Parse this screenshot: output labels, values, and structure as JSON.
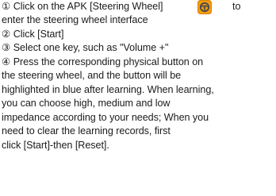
{
  "instructions": {
    "step1_before_icon": "① Click on the APK [Steering Wheel]",
    "step1_icon": "steering-wheel-icon",
    "step1_after_icon": "to",
    "step1_line2": "enter the steering wheel interface",
    "step2": "② Click [Start]",
    "step3": "③ Select one key, such as \"Volume +\"",
    "step4_lines": [
      "④ Press the corresponding physical button on",
      "the steering wheel, and the button will be",
      "highlighted in blue after learning. When learning,",
      "you can choose high, medium and low",
      "impedance according to your needs; When you",
      "need to clear the learning records, first",
      "click [Start]-then [Reset]."
    ]
  },
  "colors": {
    "text": "#1b1b1b",
    "icon_orange": "#f39c12",
    "icon_wheel": "#4a4a4a"
  }
}
